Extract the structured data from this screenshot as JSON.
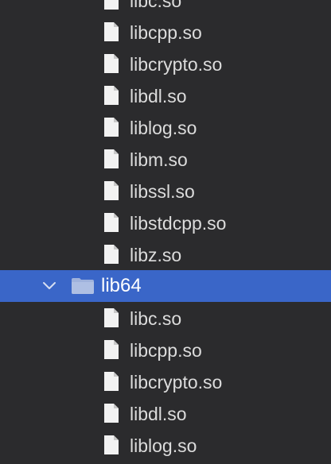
{
  "tree": {
    "group_a": [
      {
        "label": "libc.so",
        "icon": "file-icon"
      },
      {
        "label": "libcpp.so",
        "icon": "file-icon"
      },
      {
        "label": "libcrypto.so",
        "icon": "file-icon"
      },
      {
        "label": "libdl.so",
        "icon": "file-icon"
      },
      {
        "label": "liblog.so",
        "icon": "file-icon"
      },
      {
        "label": "libm.so",
        "icon": "file-icon"
      },
      {
        "label": "libssl.so",
        "icon": "file-icon"
      },
      {
        "label": "libstdcpp.so",
        "icon": "file-icon"
      },
      {
        "label": "libz.so",
        "icon": "file-icon"
      }
    ],
    "folder": {
      "label": "lib64",
      "icon": "folder-icon",
      "expanded": true,
      "selected": true,
      "selection_color": "#3a66c8"
    },
    "group_b": [
      {
        "label": "libc.so",
        "icon": "file-icon"
      },
      {
        "label": "libcpp.so",
        "icon": "file-icon"
      },
      {
        "label": "libcrypto.so",
        "icon": "file-icon"
      },
      {
        "label": "libdl.so",
        "icon": "file-icon"
      },
      {
        "label": "liblog.so",
        "icon": "file-icon"
      }
    ]
  }
}
